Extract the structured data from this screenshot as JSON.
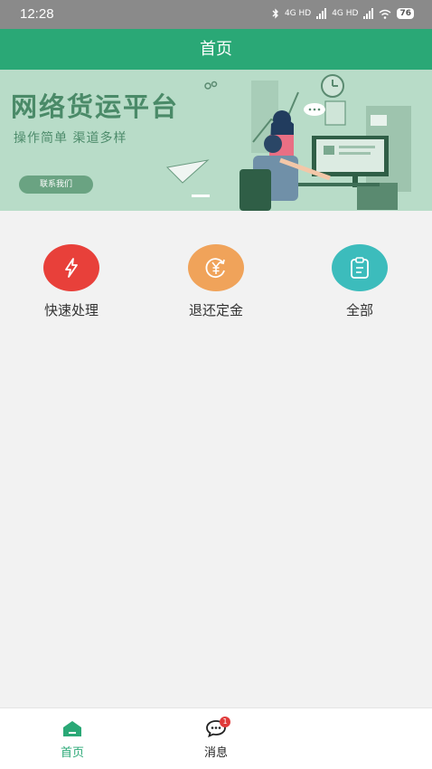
{
  "status_bar": {
    "time": "12:28",
    "network_1": "4G HD",
    "network_2": "4G HD",
    "battery": "76",
    "icons": [
      "bluetooth-icon",
      "signal-icon",
      "wifi-icon",
      "battery-icon"
    ]
  },
  "header": {
    "title": "首页"
  },
  "banner": {
    "title": "网络货运平台",
    "subtitle": "操作简单 渠道多样",
    "button_label": "联系我们"
  },
  "actions": [
    {
      "label": "快速处理",
      "icon": "lightning-icon",
      "color": "#e8403a"
    },
    {
      "label": "退还定金",
      "icon": "yuan-refund-icon",
      "color": "#f0a35a"
    },
    {
      "label": "全部",
      "icon": "clipboard-icon",
      "color": "#3cbcbc"
    }
  ],
  "tabbar": {
    "items": [
      {
        "label": "首页",
        "icon": "home-icon",
        "active": true
      },
      {
        "label": "消息",
        "icon": "chat-icon",
        "active": false,
        "badge": "1"
      }
    ],
    "active_color": "#2aa876"
  }
}
